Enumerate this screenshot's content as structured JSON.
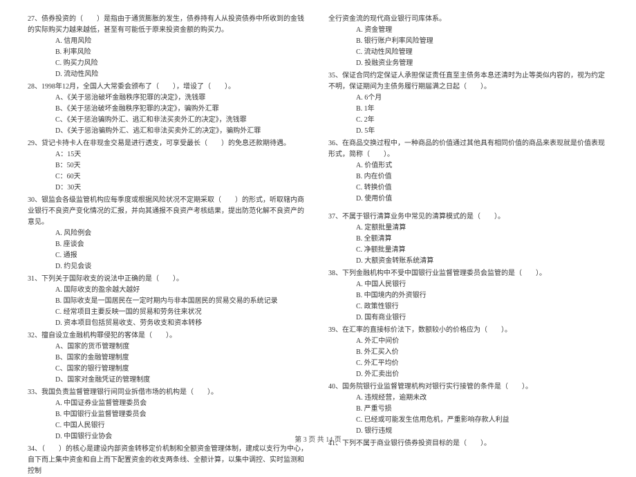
{
  "left": {
    "q27": {
      "text": "27、债券投资的（　　）是指由于通货膨胀的发生，债券持有人从投资债券中所收到的金钱的实际购买力越来越低，甚至有可能低于原来投资金额的购买力。",
      "a": "A. 信用风险",
      "b": "B. 利率风险",
      "c": "C. 购买力风险",
      "d": "D. 流动性风险"
    },
    "q28": {
      "text": "28、1998年12月，全国人大常委会颁布了（　　），增设了（　　）。",
      "a": "A、《关于惩治破坏金融秩序犯罪的决定》，洗钱罪",
      "b": "B、《关于惩治破坏金融秩序犯罪的决定》，骗购外汇罪",
      "c": "C、《关于惩治骗购外汇、逃汇和非法买卖外汇的决定》，洗钱罪",
      "d": "D、《关于惩治骗购外汇、逃汇和非法买卖外汇的决定》，骗购外汇罪"
    },
    "q29": {
      "text": "29、贷记卡持卡人在非现金交易是进行透支，可享受最长（　　）的免息还款期待遇。",
      "a": "A：15天",
      "b": "B：50天",
      "c": "C：60天",
      "d": "D：30天"
    },
    "q30": {
      "text": "30、银监会各级监管机构应每季度或根据风险状况不定期采取（　　）的形式，听取辖内商业银行不良资产变化情况的汇报，并向其通报不良资产考核结果，提出防范化解不良资产的意见。",
      "a": "A. 风险例会",
      "b": "B. 座谈会",
      "c": "C. 通报",
      "d": "D. 约见会谈"
    },
    "q31": {
      "text": "31、下列关于国际收支的说法中正确的是（　　）。",
      "a": "A. 国际收支的盈余越大越好",
      "b": "B. 国际收支是一国居民在一定时期内与非本国居民的贸易交易的系统记录",
      "c": "C. 经常项目主要反映一国的贸易和劳务往来状况",
      "d": "D. 资本项目包括贸易收支、劳务收支和资本转移"
    },
    "q32": {
      "text": "32、擅自设立金融机构罪侵犯的客体是（　　）。",
      "a": "A、国家的货币管理制度",
      "b": "B、国家的金融管理制度",
      "c": "C、国家的银行管理制度",
      "d": "D、国家对金融凭证的管理制度"
    },
    "q33": {
      "text": "33、我国负责监督管理银行间同业拆借市场的机构是（　　）。",
      "a": "A. 中国证券业监督管理委员会",
      "b": "B. 中国银行业监督管理委员会",
      "c": "C. 中国人民银行",
      "d": "D. 中国银行业协会"
    },
    "q34": {
      "text": "34、（　　）的核心是建设内部资金转移定价机制和全额资金管理体制，建成以支行为中心，自下而上集中资金和自上而下配置资金的收支两条线、全额计算，以集中调控、实时监测和控制"
    }
  },
  "right": {
    "q34c": {
      "text": "全行资金流的现代商业银行司库体系。",
      "a": "A. 资金管理",
      "b": "B. 银行账户利率风险管理",
      "c": "C. 流动性风险管理",
      "d": "D. 投融资业务管理"
    },
    "q35": {
      "text": "35、保证合同约定保证人承担保证责任直至主债务本息还清时为止等类似内容的，视为约定不明，保证期间为主债务履行期届满之日起（　　）。",
      "a": "A. 6个月",
      "b": "B. 1年",
      "c": "C. 2年",
      "d": "D. 5年"
    },
    "q36": {
      "text": "36、在商品交换过程中，一种商品的价值通过其他具有相同价值的商品来表现就是价值表现形式，简称（　　）。",
      "a": "A. 价值形式",
      "b": "B. 内在价值",
      "c": "C. 转换价值",
      "d": "D. 使用价值"
    },
    "q37": {
      "text": "37、不属于银行清算业务中常见的清算模式的是（　　）。",
      "a": "A. 定额批量清算",
      "b": "B. 全额清算",
      "c": "C. 净额批量清算",
      "d": "D. 大额资金转账系统清算"
    },
    "q38": {
      "text": "38、下列金融机构中不受中国银行业监督管理委员会监管的是（　　）。",
      "a": "A. 中国人民银行",
      "b": "B. 中国境内的外资银行",
      "c": "C. 政策性银行",
      "d": "D. 国有商业银行"
    },
    "q39": {
      "text": "39、在汇率的直接标价法下，数额较小的价格应为（　　）。",
      "a": "A. 外汇中间价",
      "b": "B. 外汇买入价",
      "c": "C. 外汇平均价",
      "d": "D. 外汇卖出价"
    },
    "q40": {
      "text": "40、国务院银行业监督管理机构对银行实行接管的条件是（　　）。",
      "a": "A. 违规经营，逾期未改",
      "b": "B. 严重亏损",
      "c": "C. 已经或可能发生信用危机，严重影响存款人利益",
      "d": "D. 银行违规"
    },
    "q41": {
      "text": "41、下列不属于商业银行债券投资目标的是（　　）。"
    }
  },
  "footer": "第 3 页 共 14 页"
}
